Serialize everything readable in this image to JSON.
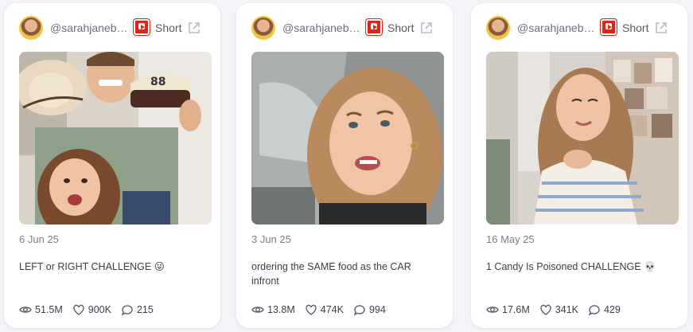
{
  "cards": [
    {
      "handle": "@sarahjanebet...",
      "platform_label": "Short",
      "date": "6 Jun 25",
      "title": "LEFT or RIGHT CHALLENGE 😛",
      "views": "51.5M",
      "likes": "900K",
      "comments": "215"
    },
    {
      "handle": "@sarahjanebet...",
      "platform_label": "Short",
      "date": "3 Jun 25",
      "title": "ordering the SAME food as the CAR infront",
      "views": "13.8M",
      "likes": "474K",
      "comments": "994"
    },
    {
      "handle": "@sarahjanebet...",
      "platform_label": "Short",
      "date": "16 May 25",
      "title": "1 Candy Is Poisoned CHALLENGE 💀",
      "views": "17.6M",
      "likes": "341K",
      "comments": "429"
    }
  ],
  "icons": {
    "platform": "youtube-icon",
    "external": "external-link-icon",
    "views": "eye-icon",
    "likes": "heart-icon",
    "comments": "comment-icon"
  },
  "colors": {
    "youtube_red": "#e62117",
    "avatar_ring": "#f5c842",
    "icon_gray": "#b7bcc6"
  }
}
